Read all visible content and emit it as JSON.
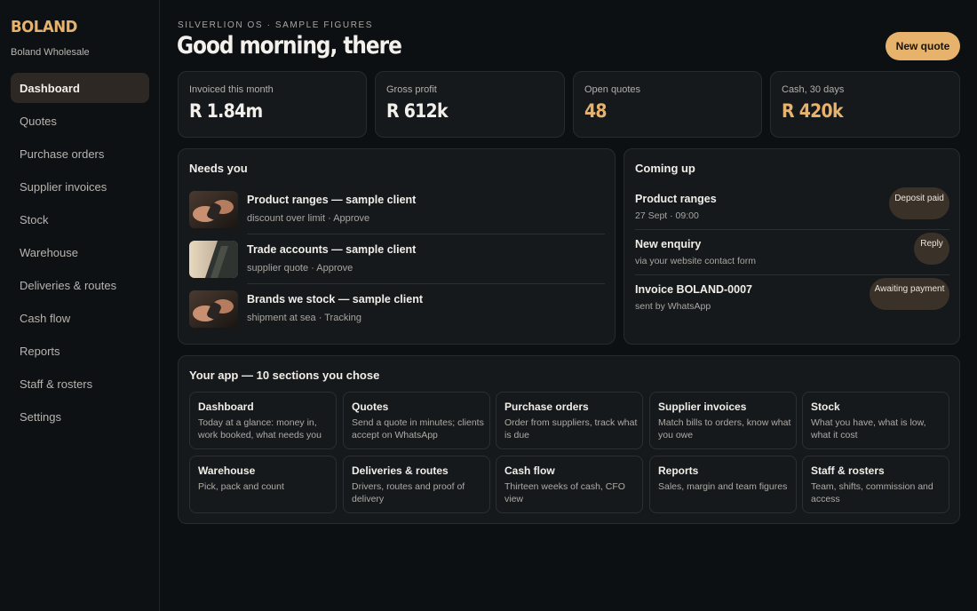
{
  "sidebar": {
    "brand": "BOLAND",
    "subtitle": "Boland Wholesale",
    "items": [
      {
        "label": "Dashboard",
        "active": true
      },
      {
        "label": "Quotes"
      },
      {
        "label": "Purchase orders"
      },
      {
        "label": "Supplier invoices"
      },
      {
        "label": "Stock"
      },
      {
        "label": "Warehouse"
      },
      {
        "label": "Deliveries & routes"
      },
      {
        "label": "Cash flow"
      },
      {
        "label": "Reports"
      },
      {
        "label": "Staff & rosters"
      },
      {
        "label": "Settings"
      }
    ]
  },
  "header": {
    "eyebrow": "SILVERLION OS · SAMPLE FIGURES",
    "greeting": "Good morning, there",
    "new_quote_label": "New quote"
  },
  "stats": [
    {
      "label": "Invoiced this month",
      "value": "R 1.84m"
    },
    {
      "label": "Gross profit",
      "value": "R 612k"
    },
    {
      "label": "Open quotes",
      "value": "48"
    },
    {
      "label": "Cash, 30 days",
      "value": "R 420k"
    }
  ],
  "needs_you": {
    "title": "Needs you",
    "items": [
      {
        "title": "Product ranges — sample client",
        "sub": "discount over limit · Approve"
      },
      {
        "title": "Trade accounts — sample client",
        "sub": "supplier quote · Approve"
      },
      {
        "title": "Brands we stock — sample client",
        "sub": "shipment at sea · Tracking"
      }
    ]
  },
  "coming_up": {
    "title": "Coming up",
    "items": [
      {
        "title": "Product ranges",
        "sub": "27 Sept · 09:00",
        "badge": "Deposit paid"
      },
      {
        "title": "New enquiry",
        "sub": "via your website contact form",
        "badge": "Reply"
      },
      {
        "title": "Invoice BOLAND-0007",
        "sub": "sent by WhatsApp",
        "badge": "Awaiting payment"
      }
    ]
  },
  "sections": {
    "title": "Your app — 10 sections you chose",
    "items": [
      {
        "title": "Dashboard",
        "desc": "Today at a glance: money in, work booked, what needs you"
      },
      {
        "title": "Quotes",
        "desc": "Send a quote in minutes; clients accept on WhatsApp"
      },
      {
        "title": "Purchase orders",
        "desc": "Order from suppliers, track what is due"
      },
      {
        "title": "Supplier invoices",
        "desc": "Match bills to orders, know what you owe"
      },
      {
        "title": "Stock",
        "desc": "What you have, what is low, what it cost"
      },
      {
        "title": "Warehouse",
        "desc": "Pick, pack and count"
      },
      {
        "title": "Deliveries & routes",
        "desc": "Drivers, routes and proof of delivery"
      },
      {
        "title": "Cash flow",
        "desc": "Thirteen weeks of cash, CFO view"
      },
      {
        "title": "Reports",
        "desc": "Sales, margin and team figures"
      },
      {
        "title": "Staff & rosters",
        "desc": "Team, shifts, commission and access"
      }
    ]
  },
  "colors": {
    "accent": "#e7b26c",
    "background": "#0d1013",
    "card": "#15191c",
    "badge": "#3a3229"
  }
}
